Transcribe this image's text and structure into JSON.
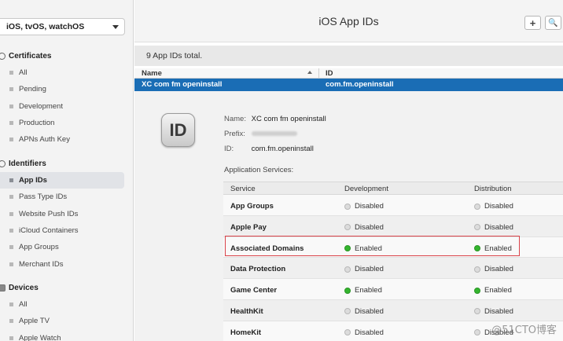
{
  "sidebar": {
    "platform": "iOS, tvOS, watchOS",
    "sections": [
      {
        "title": "Certificates",
        "items": [
          "All",
          "Pending",
          "Development",
          "Production",
          "APNs Auth Key"
        ]
      },
      {
        "title": "Identifiers",
        "items": [
          "App IDs",
          "Pass Type IDs",
          "Website Push IDs",
          "iCloud Containers",
          "App Groups",
          "Merchant IDs"
        ],
        "active": "App IDs"
      },
      {
        "title": "Devices",
        "items": [
          "All",
          "Apple TV",
          "Apple Watch"
        ]
      }
    ]
  },
  "main": {
    "title": "iOS App IDs",
    "add_label": "+",
    "search_label": "🔍",
    "summary": "9  App IDs total.",
    "columns": {
      "name": "Name",
      "id": "ID"
    },
    "selected_row": {
      "name": "XC com fm openinstall",
      "id": "com.fm.openinstall"
    },
    "detail": {
      "icon_text": "ID",
      "name_label": "Name:",
      "name_value": "XC com fm openinstall",
      "prefix_label": "Prefix:",
      "id_label": "ID:",
      "id_value": "com.fm.openinstall",
      "app_services_label": "Application Services:",
      "service_headers": {
        "service": "Service",
        "development": "Development",
        "distribution": "Distribution"
      },
      "services": [
        {
          "name": "App Groups",
          "development": "Disabled",
          "distribution": "Disabled",
          "dev_on": false,
          "dist_on": false
        },
        {
          "name": "Apple Pay",
          "development": "Disabled",
          "distribution": "Disabled",
          "dev_on": false,
          "dist_on": false
        },
        {
          "name": "Associated Domains",
          "development": "Enabled",
          "distribution": "Enabled",
          "dev_on": true,
          "dist_on": true
        },
        {
          "name": "Data Protection",
          "development": "Disabled",
          "distribution": "Disabled",
          "dev_on": false,
          "dist_on": false
        },
        {
          "name": "Game Center",
          "development": "Enabled",
          "distribution": "Enabled",
          "dev_on": true,
          "dist_on": true
        },
        {
          "name": "HealthKit",
          "development": "Disabled",
          "distribution": "Disabled",
          "dev_on": false,
          "dist_on": false
        },
        {
          "name": "HomeKit",
          "development": "Disabled",
          "distribution": "Disabled",
          "dev_on": false,
          "dist_on": false
        }
      ]
    }
  },
  "watermark": "@51CTO博客",
  "colors": {
    "selection": "#1a6db5",
    "enabled": "#34b52e",
    "highlight": "#d9434a"
  }
}
